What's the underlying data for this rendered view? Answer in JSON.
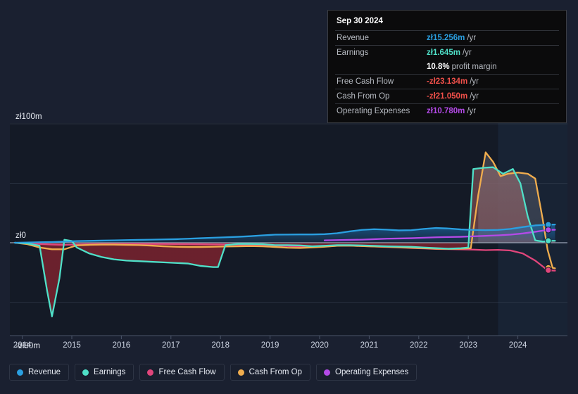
{
  "currency_symbol": "zł",
  "colors": {
    "revenue": "#2a9fe0",
    "earnings": "#4fe0c8",
    "free_cash_flow": "#e0457b",
    "cash_from_op": "#f0ad4e",
    "operating_expenses": "#b44ae8",
    "negative_value": "#f0504a",
    "plot_background": "#141a26",
    "page_background": "#1a2030",
    "gridline": "#3a4254",
    "zero_line": "#9aa3b4",
    "forecast_band": "#1a2739"
  },
  "tooltip": {
    "date": "Sep 30 2024",
    "rows": [
      {
        "label": "Revenue",
        "value": "zł15.256m",
        "unit": "/yr",
        "color_key": "revenue"
      },
      {
        "label": "Earnings",
        "value": "zł1.645m",
        "unit": "/yr",
        "color_key": "earnings"
      },
      {
        "label": "",
        "value": "10.8%",
        "unit": "profit margin",
        "color_key": "white"
      },
      {
        "label": "Free Cash Flow",
        "value": "-zł23.134m",
        "unit": "/yr",
        "color_key": "negative_value"
      },
      {
        "label": "Cash From Op",
        "value": "-zł21.050m",
        "unit": "/yr",
        "color_key": "negative_value"
      },
      {
        "label": "Operating Expenses",
        "value": "zł10.780m",
        "unit": "/yr",
        "color_key": "operating_expenses"
      }
    ]
  },
  "legend": {
    "items": [
      {
        "label": "Revenue",
        "color": "#2a9fe0"
      },
      {
        "label": "Earnings",
        "color": "#4fe0c8"
      },
      {
        "label": "Free Cash Flow",
        "color": "#e0457b"
      },
      {
        "label": "Cash From Op",
        "color": "#f0ad4e"
      },
      {
        "label": "Operating Expenses",
        "color": "#b44ae8"
      }
    ]
  },
  "chart_data": {
    "type": "line",
    "title": "",
    "xlabel": "",
    "ylabel": "",
    "xlim": [
      2013.75,
      2025.0
    ],
    "ylim": [
      -80,
      100
    ],
    "grid": true,
    "legend_position": "bottom",
    "y_ticks": [
      {
        "value": 100,
        "label": "zł100m"
      },
      {
        "value": 50,
        "label": ""
      },
      {
        "value": 0,
        "label": "zł0"
      },
      {
        "value": -50,
        "label": ""
      },
      {
        "value": -80,
        "label": "-zł80m"
      }
    ],
    "x_ticks": [
      {
        "value": 2014,
        "label": "2014"
      },
      {
        "value": 2015,
        "label": "2015"
      },
      {
        "value": 2016,
        "label": "2016"
      },
      {
        "value": 2017,
        "label": "2017"
      },
      {
        "value": 2018,
        "label": "2018"
      },
      {
        "value": 2019,
        "label": "2019"
      },
      {
        "value": 2020,
        "label": "2020"
      },
      {
        "value": 2021,
        "label": "2021"
      },
      {
        "value": 2022,
        "label": "2022"
      },
      {
        "value": 2023,
        "label": "2023"
      },
      {
        "value": 2024,
        "label": "2024"
      }
    ],
    "units": "zł millions per year",
    "forecast_band": {
      "start": 2023.6,
      "end": 2025.0
    },
    "series": [
      {
        "name": "Revenue",
        "color": "#2a9fe0",
        "x": [
          2013.85,
          2014.1,
          2014.35,
          2014.6,
          2014.85,
          2015.1,
          2015.35,
          2015.6,
          2015.85,
          2016.1,
          2016.35,
          2016.6,
          2016.85,
          2017.1,
          2017.35,
          2017.6,
          2017.85,
          2018.1,
          2018.35,
          2018.6,
          2018.85,
          2019.1,
          2019.35,
          2019.6,
          2019.85,
          2020.1,
          2020.35,
          2020.6,
          2020.85,
          2021.1,
          2021.35,
          2021.6,
          2021.85,
          2022.1,
          2022.35,
          2022.6,
          2022.85,
          2023.1,
          2023.35,
          2023.6,
          2023.85,
          2024.1,
          2024.35,
          2024.6,
          2024.75
        ],
        "values": [
          0.0,
          0.2,
          0.4,
          0.6,
          1.0,
          1.4,
          1.6,
          1.8,
          2.0,
          2.2,
          2.4,
          2.6,
          2.8,
          3.0,
          3.4,
          3.8,
          4.2,
          4.6,
          5.0,
          5.5,
          6.2,
          6.8,
          6.9,
          7.0,
          7.0,
          7.2,
          8.0,
          9.5,
          10.8,
          11.4,
          11.0,
          10.4,
          10.6,
          11.6,
          12.4,
          12.0,
          11.2,
          10.8,
          10.6,
          10.8,
          11.6,
          13.2,
          14.6,
          15.256,
          15.3
        ]
      },
      {
        "name": "Earnings",
        "color": "#4fe0c8",
        "x": [
          2013.85,
          2014.1,
          2014.35,
          2014.5,
          2014.6,
          2014.75,
          2014.85,
          2015.0,
          2015.1,
          2015.35,
          2015.6,
          2015.85,
          2016.1,
          2016.35,
          2016.6,
          2016.85,
          2017.1,
          2017.35,
          2017.6,
          2017.85,
          2017.95,
          2018.1,
          2018.35,
          2018.6,
          2018.85,
          2019.1,
          2019.35,
          2019.6,
          2019.85,
          2020.1,
          2020.35,
          2020.6,
          2020.85,
          2021.1,
          2021.35,
          2021.6,
          2021.85,
          2022.1,
          2022.35,
          2022.6,
          2022.85,
          2023.0,
          2023.1,
          2023.3,
          2023.5,
          2023.7,
          2023.9,
          2024.05,
          2024.2,
          2024.35,
          2024.5,
          2024.6,
          2024.7,
          2024.75
        ],
        "values": [
          0.0,
          -0.6,
          -2.5,
          -40.0,
          -62.0,
          -30.0,
          2.5,
          1.5,
          -4.0,
          -9.0,
          -12.0,
          -14.0,
          -15.0,
          -15.5,
          -16.0,
          -16.5,
          -17.0,
          -17.5,
          -19.5,
          -20.5,
          -20.5,
          -2.0,
          -1.0,
          -1.0,
          -1.2,
          -2.0,
          -2.0,
          -2.2,
          -3.0,
          -2.5,
          -2.0,
          -2.0,
          -2.2,
          -2.6,
          -3.0,
          -3.2,
          -3.4,
          -4.0,
          -4.5,
          -5.0,
          -4.6,
          -4.0,
          62.0,
          63.0,
          63.5,
          58.0,
          62.0,
          50.0,
          22.0,
          2.0,
          1.0,
          1.2,
          1.645,
          1.645
        ]
      },
      {
        "name": "Free Cash Flow",
        "color": "#e0457b",
        "x": [
          2013.85,
          2014.1,
          2014.35,
          2014.6,
          2014.85,
          2015.1,
          2015.35,
          2015.6,
          2015.85,
          2016.1,
          2016.35,
          2016.6,
          2016.85,
          2017.1,
          2017.35,
          2017.6,
          2017.85,
          2018.1,
          2018.35,
          2018.6,
          2018.85,
          2019.1,
          2019.35,
          2019.6,
          2019.85,
          2020.1,
          2020.35,
          2020.6,
          2020.85,
          2021.1,
          2021.35,
          2021.6,
          2021.85,
          2022.1,
          2022.35,
          2022.6,
          2022.85,
          2023.1,
          2023.35,
          2023.6,
          2023.85,
          2024.1,
          2024.35,
          2024.6,
          2024.75
        ],
        "values": [
          0.0,
          -0.5,
          -1.0,
          -1.5,
          -1.8,
          -1.5,
          -1.2,
          -1.0,
          -0.9,
          -0.9,
          -0.9,
          -1.0,
          -1.0,
          -1.1,
          -1.2,
          -1.3,
          -1.4,
          -1.5,
          -1.6,
          -1.8,
          -2.0,
          -2.4,
          -2.8,
          -3.2,
          -3.6,
          -3.2,
          -2.6,
          -2.4,
          -2.8,
          -3.2,
          -3.6,
          -4.0,
          -4.4,
          -4.8,
          -5.2,
          -5.4,
          -5.6,
          -5.8,
          -6.2,
          -6.0,
          -6.5,
          -9.0,
          -15.0,
          -23.134,
          -23.5
        ]
      },
      {
        "name": "Cash From Op",
        "color": "#f0ad4e",
        "x": [
          2013.85,
          2014.1,
          2014.35,
          2014.6,
          2014.85,
          2015.1,
          2015.35,
          2015.6,
          2015.85,
          2016.1,
          2016.35,
          2016.6,
          2016.85,
          2017.1,
          2017.35,
          2017.6,
          2017.85,
          2018.1,
          2018.35,
          2018.6,
          2018.85,
          2019.1,
          2019.35,
          2019.6,
          2019.85,
          2020.1,
          2020.35,
          2020.6,
          2020.85,
          2021.1,
          2021.35,
          2021.6,
          2021.85,
          2022.1,
          2022.35,
          2022.6,
          2022.85,
          2023.05,
          2023.2,
          2023.35,
          2023.5,
          2023.65,
          2023.8,
          2024.0,
          2024.2,
          2024.35,
          2024.5,
          2024.6,
          2024.7,
          2024.75
        ],
        "values": [
          0.0,
          -1.2,
          -4.0,
          -5.5,
          -5.5,
          -2.2,
          -1.8,
          -1.6,
          -1.6,
          -1.8,
          -2.0,
          -2.4,
          -3.0,
          -3.4,
          -3.6,
          -3.6,
          -3.4,
          -3.2,
          -3.0,
          -2.8,
          -3.0,
          -3.6,
          -4.2,
          -4.4,
          -4.0,
          -3.4,
          -2.6,
          -2.4,
          -2.8,
          -3.2,
          -3.4,
          -3.8,
          -4.2,
          -4.6,
          -5.0,
          -5.2,
          -5.0,
          -4.6,
          40.0,
          76.0,
          68.0,
          56.0,
          58.0,
          59.0,
          58.0,
          54.0,
          20.0,
          -6.0,
          -21.05,
          -21.5
        ]
      },
      {
        "name": "Operating Expenses",
        "color": "#b44ae8",
        "x": [
          2020.1,
          2020.35,
          2020.6,
          2020.85,
          2021.1,
          2021.35,
          2021.6,
          2021.85,
          2022.1,
          2022.35,
          2022.6,
          2022.85,
          2023.1,
          2023.35,
          2023.6,
          2023.85,
          2024.1,
          2024.35,
          2024.6,
          2024.75
        ],
        "values": [
          2.0,
          2.2,
          2.4,
          2.6,
          3.0,
          3.4,
          3.6,
          3.8,
          4.2,
          4.6,
          4.8,
          5.0,
          5.4,
          5.8,
          6.2,
          6.8,
          7.8,
          9.2,
          10.78,
          10.9
        ]
      }
    ],
    "end_markers": [
      {
        "series": "Revenue",
        "value": 15.256,
        "color": "#2a9fe0"
      },
      {
        "series": "Operating Expenses",
        "value": 10.78,
        "color": "#b44ae8"
      },
      {
        "series": "Earnings",
        "value": 1.645,
        "color": "#4fe0c8"
      },
      {
        "series": "Cash From Op",
        "value": -21.05,
        "color": "#f0ad4e"
      },
      {
        "series": "Free Cash Flow",
        "value": -23.134,
        "color": "#e0457b"
      }
    ]
  }
}
